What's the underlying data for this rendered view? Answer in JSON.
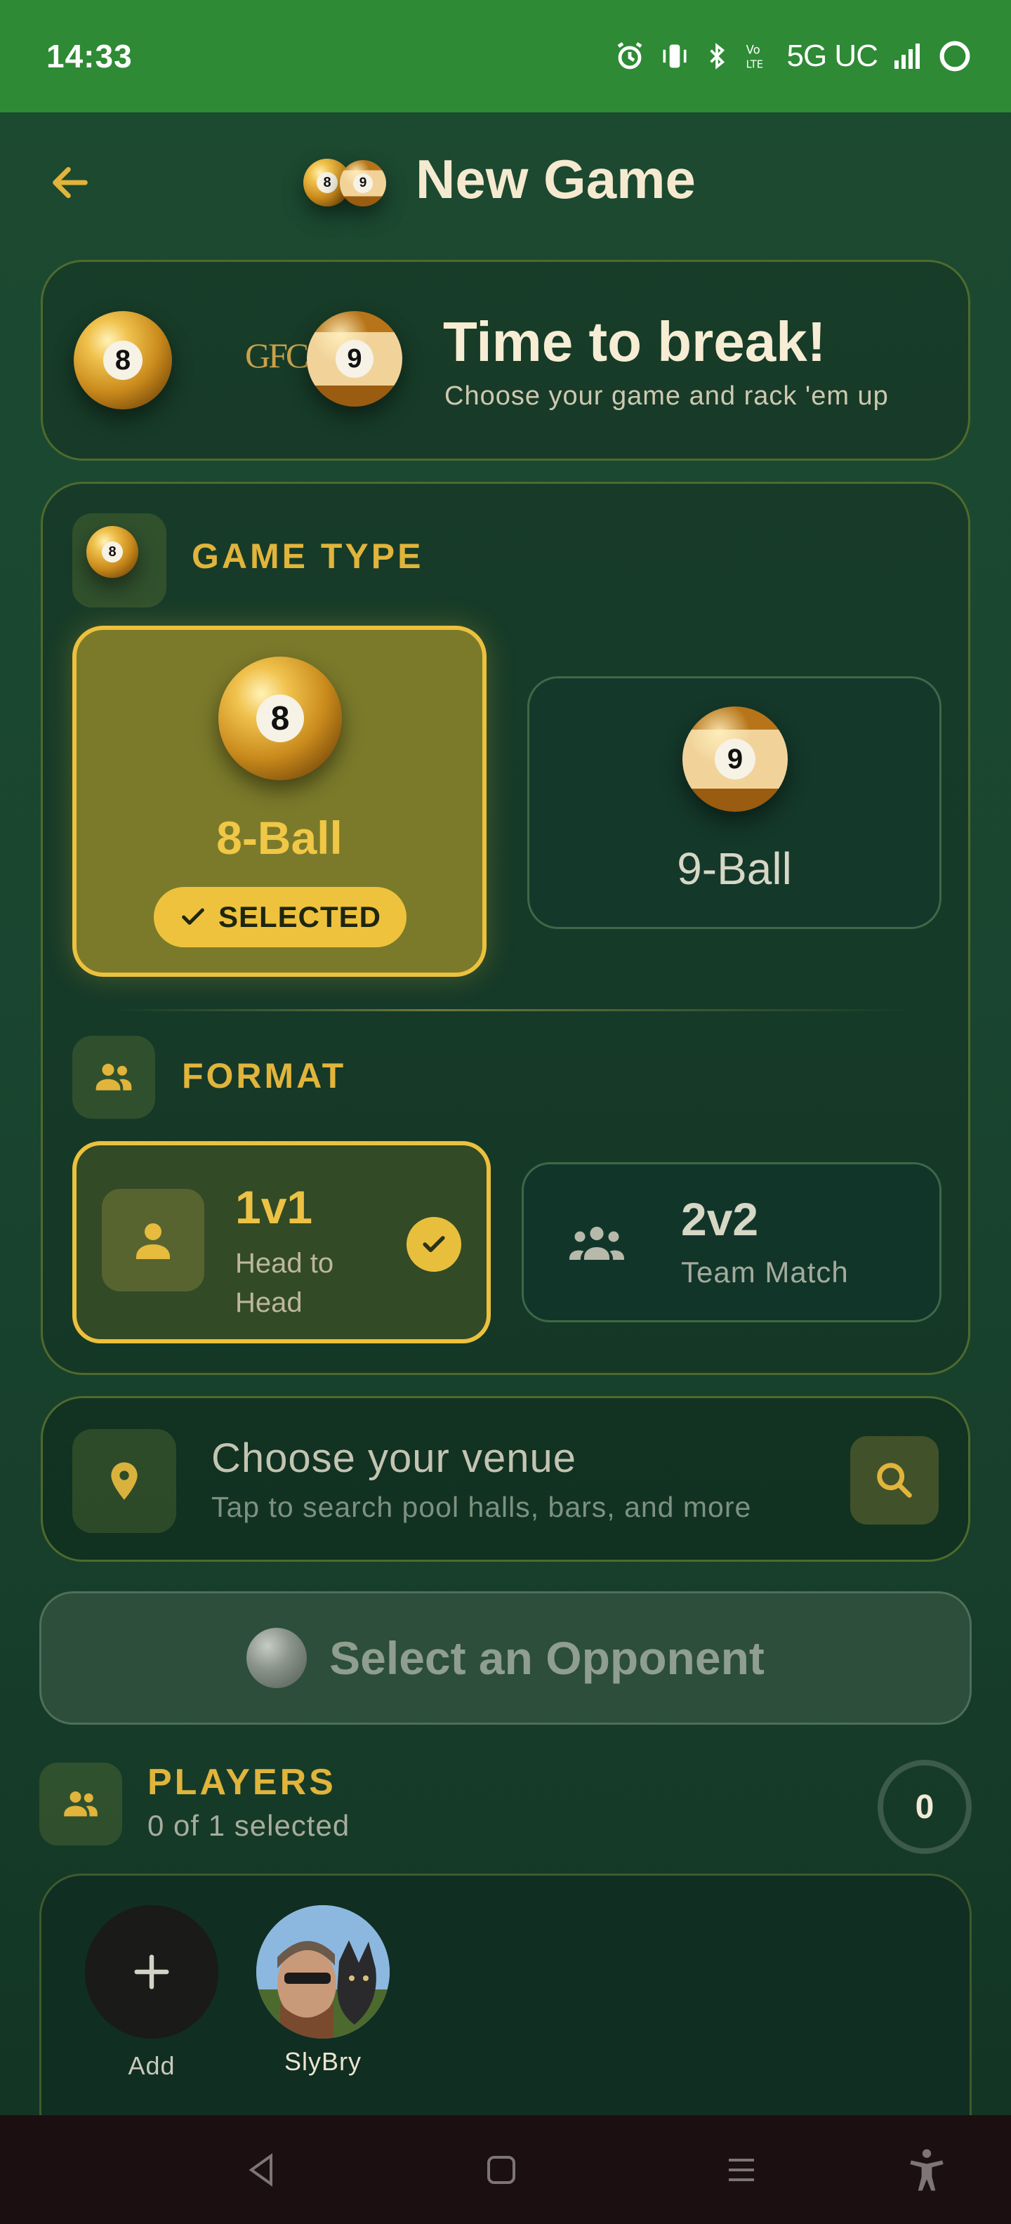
{
  "status_bar": {
    "time": "14:33",
    "network": "5G UC",
    "icons": [
      "alarm-icon",
      "vibrate-icon",
      "bluetooth-icon",
      "volte-icon",
      "signal-icon",
      "battery-ring-icon"
    ]
  },
  "header": {
    "title": "New Game",
    "back_icon": "arrow-left-icon"
  },
  "hero": {
    "title": "Time to break!",
    "subtitle": "Choose your game and rack 'em up",
    "logo_text": "GFC",
    "ball_left_number": "8",
    "ball_right_number": "9"
  },
  "game_type": {
    "section_title": "GAME TYPE",
    "options": [
      {
        "label": "8-Ball",
        "number": "8",
        "selected": true
      },
      {
        "label": "9-Ball",
        "number": "9",
        "selected": false
      }
    ],
    "selected_badge": "SELECTED"
  },
  "format": {
    "section_title": "FORMAT",
    "options": [
      {
        "title": "1v1",
        "subtitle": "Head to Head",
        "selected": true
      },
      {
        "title": "2v2",
        "subtitle": "Team Match",
        "selected": false
      }
    ]
  },
  "venue": {
    "title": "Choose your venue",
    "subtitle": "Tap to search pool halls, bars, and more"
  },
  "opponent_button": {
    "label": "Select an Opponent"
  },
  "players": {
    "section_title": "PLAYERS",
    "subtitle": "0 of 1 selected",
    "count": "0",
    "add_label": "Add",
    "list": [
      {
        "name": "SlyBry"
      }
    ]
  },
  "colors": {
    "accent_gold": "#ecc13d",
    "status_bar_green": "#2e8a35",
    "background_green": "#1a4630"
  }
}
